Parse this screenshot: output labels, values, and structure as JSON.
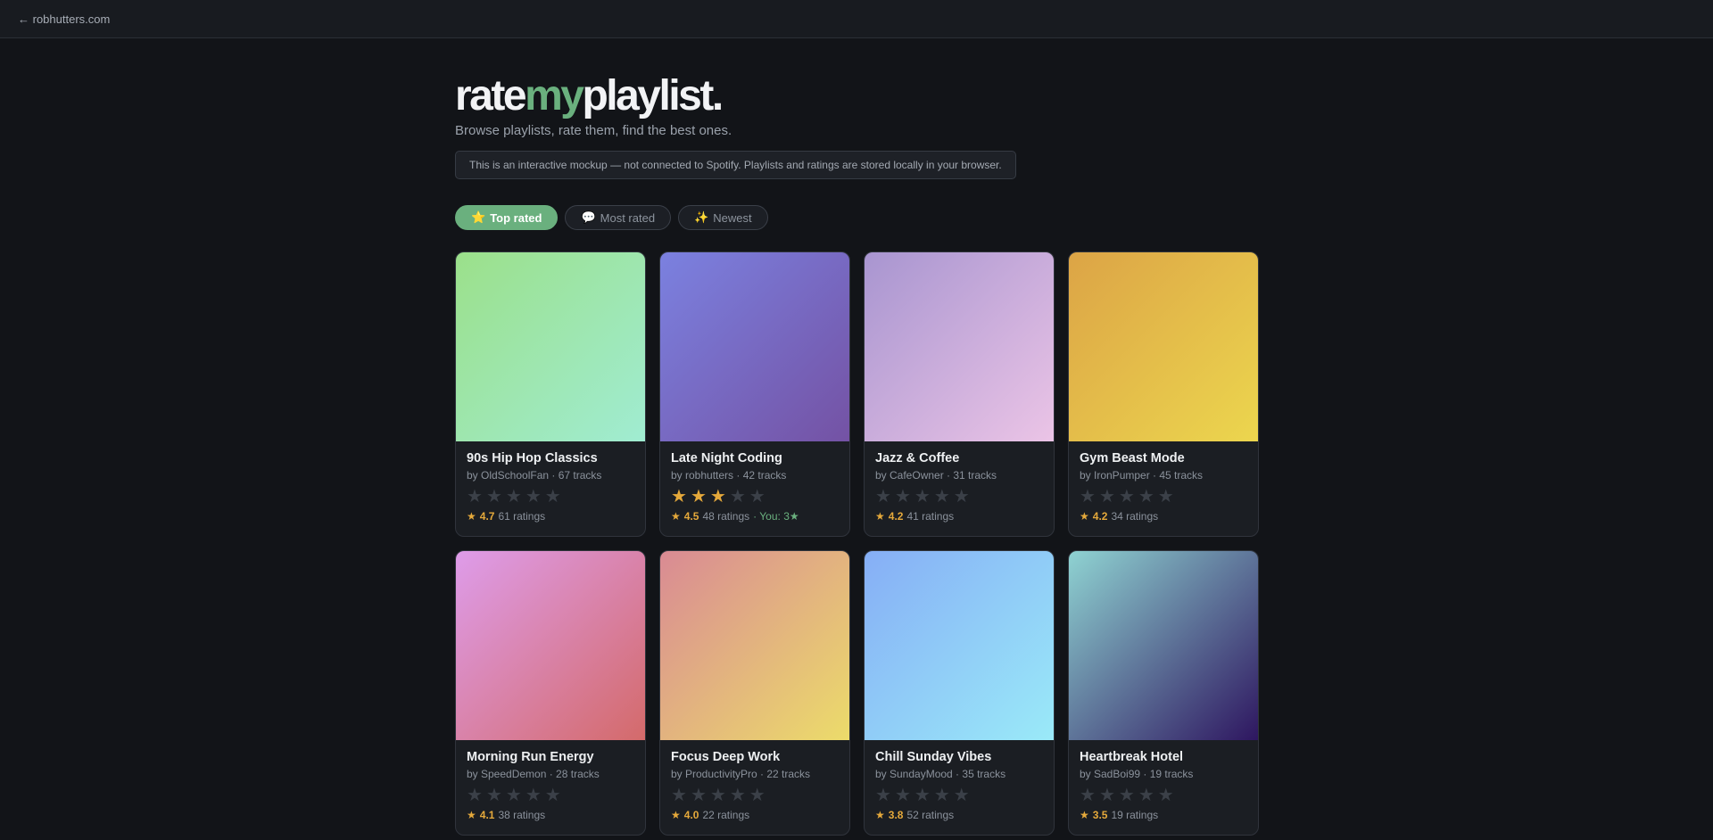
{
  "topbar": {
    "back_label": "← robhutters.com"
  },
  "brand": {
    "part1": "rate",
    "part2": "my",
    "part3": "playlist."
  },
  "tagline": "Browse playlists, rate them, find the best ones.",
  "notice": "This is an interactive mockup — not connected to Spotify. Playlists and ratings are stored locally in your browser.",
  "filters": [
    {
      "icon": "⭐",
      "label": "Top rated",
      "active": true
    },
    {
      "icon": "💬",
      "label": "Most rated",
      "active": false
    },
    {
      "icon": "✨",
      "label": "Newest",
      "active": false
    }
  ],
  "star_glyph": "★",
  "playlists": [
    {
      "title": "90s Hip Hop Classics",
      "meta": "by OldSchoolFan · 67 tracks",
      "avg": "4.7",
      "count": "61 ratings",
      "user_rating": 0,
      "you": "",
      "gradient": [
        "#9be08a",
        "#a0ecd2"
      ]
    },
    {
      "title": "Late Night Coding",
      "meta": "by robhutters · 42 tracks",
      "avg": "4.5",
      "count": "48 ratings",
      "user_rating": 3,
      "you": "· You: 3★",
      "gradient": [
        "#7b81e0",
        "#7452a4"
      ]
    },
    {
      "title": "Jazz & Coffee",
      "meta": "by CafeOwner · 31 tracks",
      "avg": "4.2",
      "count": "41 ratings",
      "user_rating": 0,
      "you": "",
      "gradient": [
        "#a895d0",
        "#ebc4e6"
      ]
    },
    {
      "title": "Gym Beast Mode",
      "meta": "by IronPumper · 45 tracks",
      "avg": "4.2",
      "count": "34 ratings",
      "user_rating": 0,
      "you": "",
      "gradient": [
        "#dca446",
        "#ecd64e"
      ]
    },
    {
      "title": "Morning Run Energy",
      "meta": "by SpeedDemon · 28 tracks",
      "avg": "4.1",
      "count": "38 ratings",
      "user_rating": 0,
      "you": "",
      "gradient": [
        "#de9cea",
        "#d46a6a"
      ]
    },
    {
      "title": "Focus Deep Work",
      "meta": "by ProductivityPro · 22 tracks",
      "avg": "4.0",
      "count": "22 ratings",
      "user_rating": 0,
      "you": "",
      "gradient": [
        "#d98a94",
        "#ecdc6a"
      ]
    },
    {
      "title": "Chill Sunday Vibes",
      "meta": "by SundayMood · 35 tracks",
      "avg": "3.8",
      "count": "52 ratings",
      "user_rating": 0,
      "you": "",
      "gradient": [
        "#86aef6",
        "#9aeaf8"
      ]
    },
    {
      "title": "Heartbreak Hotel",
      "meta": "by SadBoi99 · 19 tracks",
      "avg": "3.5",
      "count": "19 ratings",
      "user_rating": 0,
      "you": "",
      "gradient": [
        "#8fd3d2",
        "#2e1660"
      ]
    }
  ]
}
